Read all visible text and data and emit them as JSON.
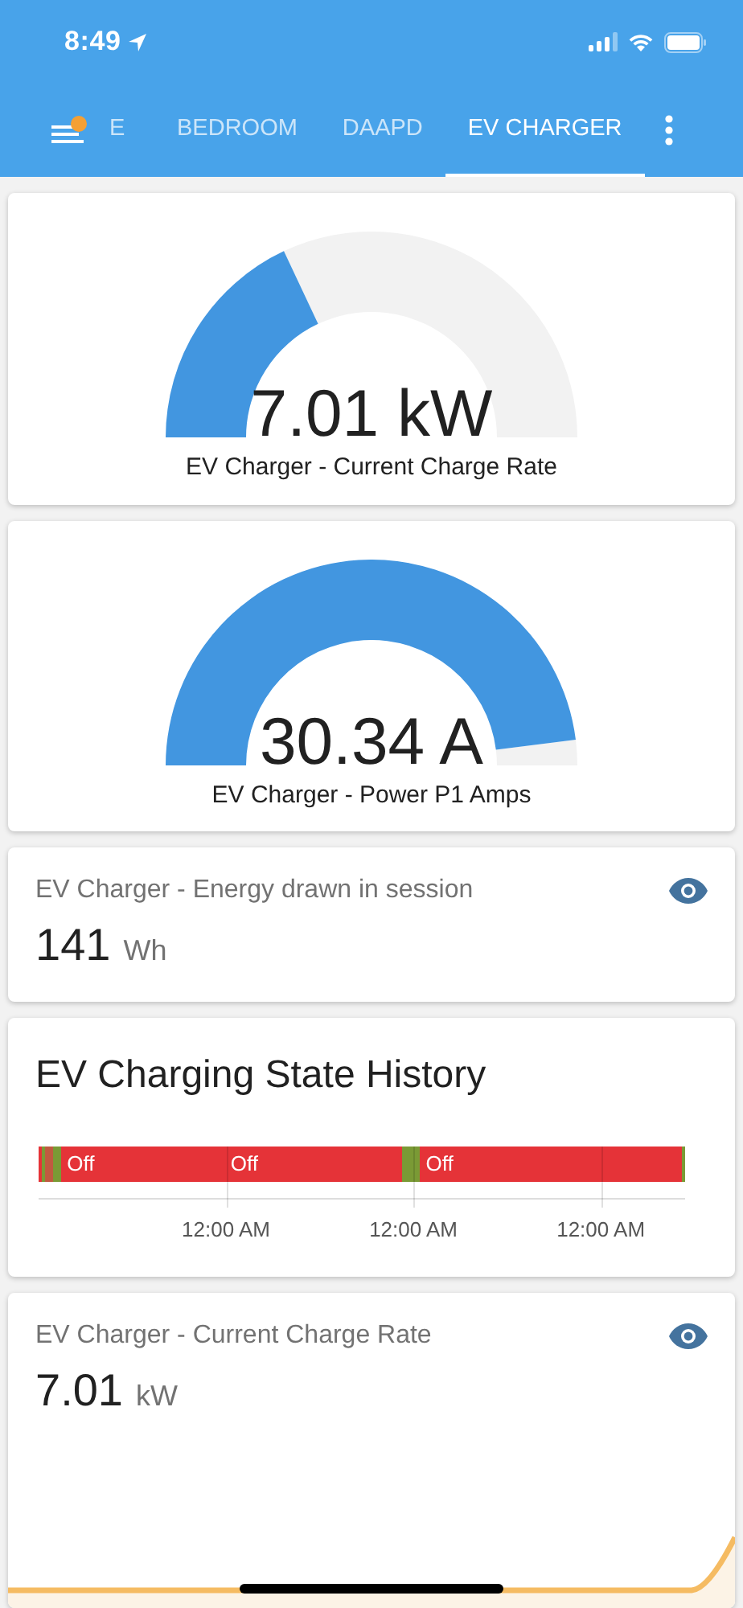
{
  "status_bar": {
    "time": "8:49"
  },
  "toolbar": {
    "menu_badge": true,
    "tabs": [
      {
        "label": "E",
        "selected": false
      },
      {
        "label": "BEDROOM",
        "selected": false
      },
      {
        "label": "DAAPD",
        "selected": false
      },
      {
        "label": "EV CHARGER",
        "selected": true
      }
    ]
  },
  "cards": [
    {
      "kind": "gauge",
      "value": "7.01 kW",
      "name": "EV Charger - Current Charge Rate"
    },
    {
      "kind": "gauge",
      "value": "30.34 A",
      "name": "EV Charger - Power P1 Amps"
    },
    {
      "kind": "sensor",
      "name": "EV Charger - Energy drawn in session",
      "value": "141",
      "unit": "Wh"
    },
    {
      "kind": "history",
      "title": "EV Charging State History",
      "segments": [
        {
          "color": "#e53338"
        },
        {
          "color": "#7a9a35"
        },
        {
          "color": "#c05a40"
        },
        {
          "color": "#7a9a35"
        },
        {
          "color": "#e53338",
          "label": "Off"
        },
        {
          "color": "#e53338",
          "label": "Off"
        },
        {
          "color": "#7a9a35"
        },
        {
          "color": "#e53338",
          "label": "Off"
        },
        {
          "color": "#7a9a35"
        }
      ],
      "ticks": [
        "12:00 AM",
        "12:00 AM",
        "12:00 AM"
      ]
    },
    {
      "kind": "sensor_graph",
      "name": "EV Charger - Current Charge Rate",
      "value": "7.01",
      "unit": "kW"
    }
  ]
}
